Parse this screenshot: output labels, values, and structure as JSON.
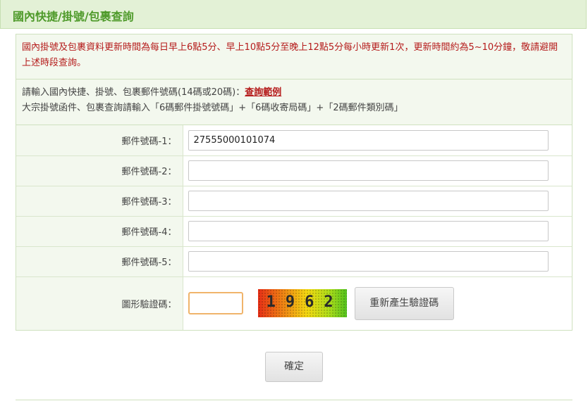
{
  "header": {
    "title": "國內快捷/掛號/包裹查詢"
  },
  "notice": {
    "text": "國內掛號及包裹資料更新時間為每日早上6點5分、早上10點5分至晚上12點5分每小時更新1次，更新時間約為5~10分鐘，敬請避開上述時段查詢。"
  },
  "instructions": {
    "line1_prefix": "請輸入國內快捷、掛號、包裹郵件號碼(14碼或20碼)：",
    "example_link": "查詢範例",
    "line2": "大宗掛號函件、包裹查詢請輸入「6碼郵件掛號號碼」+「6碼收寄局碼」+「2碼郵件類別碼」"
  },
  "fields": [
    {
      "label": "郵件號碼-1：",
      "value": "27555000101074"
    },
    {
      "label": "郵件號碼-2：",
      "value": ""
    },
    {
      "label": "郵件號碼-3：",
      "value": ""
    },
    {
      "label": "郵件號碼-4：",
      "value": ""
    },
    {
      "label": "郵件號碼-5：",
      "value": ""
    }
  ],
  "captcha": {
    "label": "圖形驗證碼：",
    "value": "",
    "image_text": "1962",
    "regenerate_label": "重新產生驗證碼"
  },
  "submit_label": "確定",
  "colors": {
    "header_bg": "#e3f1d6",
    "title": "#4e9a2a",
    "notice_text": "#b51b1b",
    "label_bg": "#f3f8ee"
  }
}
